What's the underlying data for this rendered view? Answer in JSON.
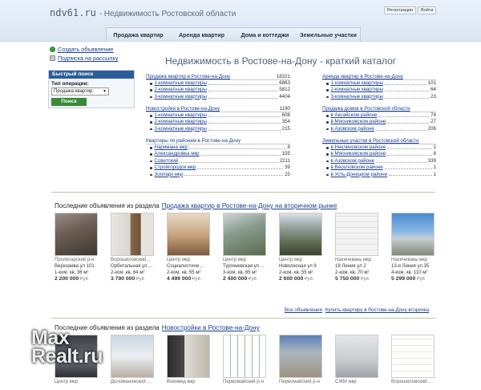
{
  "header": {
    "logo": "ndv61.ru",
    "tagline": "- Недвижимость Ростовской области",
    "register": "Регистрация",
    "login": "Войти"
  },
  "nav": [
    "Продажа квартир",
    "Аренда квартир",
    "Дома и коттеджи",
    "Земельные участки"
  ],
  "sidebar": {
    "add_ad": "Создать объявление",
    "subscribe": "Подписка на рассылку"
  },
  "fast_search": {
    "title": "Быстрый поиск",
    "label": "Тип операции:",
    "selected": "Продажа квартир",
    "button": "Поиск"
  },
  "catalog": {
    "title": "Недвижимость в Ростове-на-Дону - краткий каталог",
    "blocks": [
      {
        "head": "Продажа квартир в Ростове-на-Дону",
        "count": "18321",
        "items": [
          {
            "label": "1-комнатные квартиры",
            "count": "6863"
          },
          {
            "label": "2-комнатные квартиры",
            "count": "5812"
          },
          {
            "label": "3-комнатные квартиры",
            "count": "4404"
          }
        ]
      },
      {
        "head": "Новостройки в Ростове-на-Дону",
        "count": "1190",
        "items": [
          {
            "label": "1-комнатные квартиры",
            "count": "608"
          },
          {
            "label": "2-комнатные квартиры",
            "count": "354"
          },
          {
            "label": "3-комнатные квартиры",
            "count": "215"
          }
        ]
      },
      {
        "head": "Квартиры по районам в Ростове-на-Дону",
        "count": "",
        "items": [
          {
            "label": "Нариманa мкр",
            "count": "8"
          },
          {
            "label": "Александровка мкр",
            "count": "155"
          },
          {
            "label": "Советский",
            "count": "2211"
          },
          {
            "label": "Стройгородок мкр",
            "count": "39"
          },
          {
            "label": "Зоопарк мкр",
            "count": "25"
          }
        ]
      },
      {
        "head": "Аренда квартир в Ростове-на-Дону",
        "count": "",
        "items": [
          {
            "label": "1-комнатные квартиры",
            "count": "101"
          },
          {
            "label": "2-комнатные квартиры",
            "count": "64"
          },
          {
            "label": "3-комнатные квартиры",
            "count": "23"
          }
        ]
      },
      {
        "head": "Продажа домов в Ростовской области",
        "count": "",
        "items": [
          {
            "label": "в Аксайском районе",
            "count": "74"
          },
          {
            "label": "в Мясниковском районе",
            "count": "27"
          },
          {
            "label": "в Азовском районе",
            "count": "206"
          }
        ]
      },
      {
        "head": "Земельные участки в Ростовской области",
        "count": "",
        "items": [
          {
            "label": "в Неклиновском районе",
            "count": "1"
          },
          {
            "label": "в Мясниковском районе",
            "count": "8"
          },
          {
            "label": "в Азовском районе",
            "count": "339"
          },
          {
            "label": "в Веселовском районе",
            "count": "1"
          },
          {
            "label": "в Усть-Донецком районе",
            "count": "1"
          }
        ]
      }
    ]
  },
  "section1": {
    "prefix": "Последние объявления из раздела",
    "link": "Продажа квартир в Ростове-на-Дону на вторичном рынке",
    "cards": [
      {
        "addr": "Пролетарский р-н",
        "addr2": "Верхоаева ул 101",
        "det": "1-ком. кв. 36 м²",
        "price": "2 200 000",
        "cur": "Руб"
      },
      {
        "addr": "Ворошиловский...",
        "addr2": "Орбитальная ул ...",
        "det": "2-ком. кв. 64 м²",
        "price": "3 790 000",
        "cur": "Руб"
      },
      {
        "addr": "Центр мкр",
        "addr2": "Социалистиче...",
        "det": "2-ком. кв. 55 м²",
        "price": "4 499 000",
        "cur": "Руб"
      },
      {
        "addr": "Центр мкр",
        "addr2": "Тургеневская ул ...",
        "det": "3-ком. кв. 65 м²",
        "price": "2 400 000",
        "cur": "Руб"
      },
      {
        "addr": "Центр мкр",
        "addr2": "Новолесная ул 9",
        "det": "2-ком. кв. 55 м²",
        "price": "2 600 000",
        "cur": "Руб"
      },
      {
        "addr": "Нахичевань мкр",
        "addr2": "19 Линия ул 2",
        "det": "2-ком. кв. 70 м²",
        "price": "5 750 000",
        "cur": "Руб"
      },
      {
        "addr": "Нахичевань мкр",
        "addr2": "13-я Линия ул 35",
        "det": "4-ком. кв. 110 м²",
        "price": "5 299 000",
        "cur": "Руб"
      }
    ],
    "all_label": "Все объявления",
    "buy_link": "Купить квартиру в Ростове-на-Дону вторичка"
  },
  "section2": {
    "prefix": "Последние объявления из раздела",
    "link": "Новостройки в Ростове-на-Дону",
    "cards": [
      {
        "addr": "Центр мкр"
      },
      {
        "addr": "Доломановский ..."
      },
      {
        "addr": "Военвед мкр"
      },
      {
        "addr": "Первомайский р-н"
      },
      {
        "addr": "Первомайский р-н"
      },
      {
        "addr": "СЖМ мкр"
      },
      {
        "addr": "Ворошиловский..."
      }
    ]
  },
  "watermark": "MaxRealt.ru"
}
